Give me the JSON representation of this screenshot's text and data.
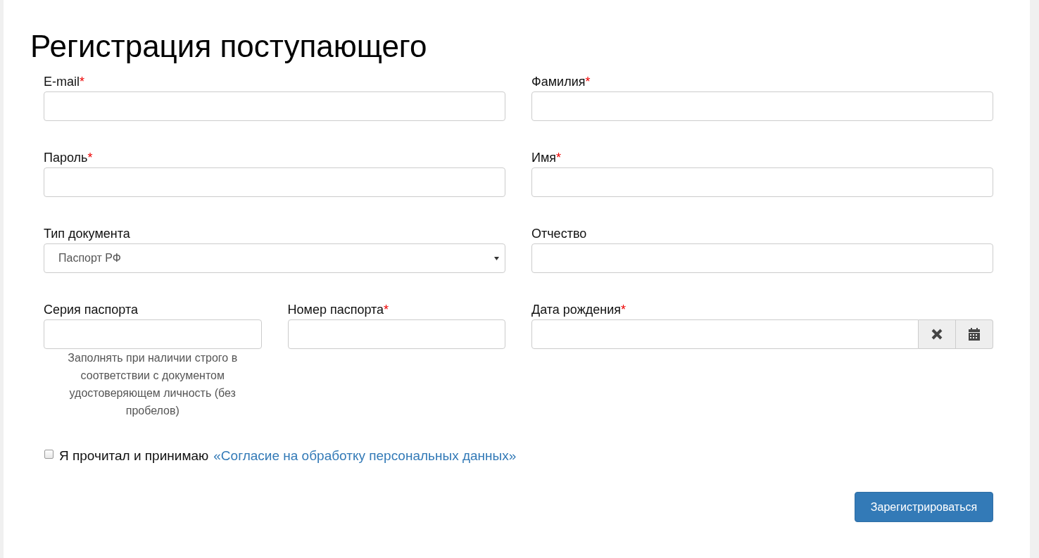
{
  "title": "Регистрация поступающего",
  "rows": [
    {
      "fields": [
        {
          "kind": "text",
          "label": "E-mail",
          "required_mark": "*"
        },
        {
          "kind": "text",
          "label": "Фамилия",
          "required_mark": "*"
        }
      ]
    },
    {
      "fields": [
        {
          "kind": "text",
          "label": "Пароль",
          "required_mark": "*"
        },
        {
          "kind": "text",
          "label": "Имя",
          "required_mark": "*"
        }
      ]
    },
    {
      "fields": [
        {
          "kind": "select",
          "label": "Тип документа",
          "value": "Паспорт РФ"
        },
        {
          "kind": "text",
          "label": "Отчество"
        }
      ]
    },
    {
      "fields": [
        {
          "kind": "text",
          "label": "Серия паспорта",
          "hint": "Заполнять при наличии строго в соответствии с документом удостоверяющем личность (без пробелов)"
        },
        {
          "kind": "text",
          "label": "Номер паспорта",
          "required_mark": "*"
        },
        {
          "kind": "date",
          "label": "Дата рождения",
          "required_mark": "*"
        }
      ]
    }
  ],
  "consent": {
    "checked": false,
    "text": "Я прочитал и принимаю",
    "link": "«Согласие на обработку персональных данных»"
  },
  "submit": "Зарегистрироваться"
}
